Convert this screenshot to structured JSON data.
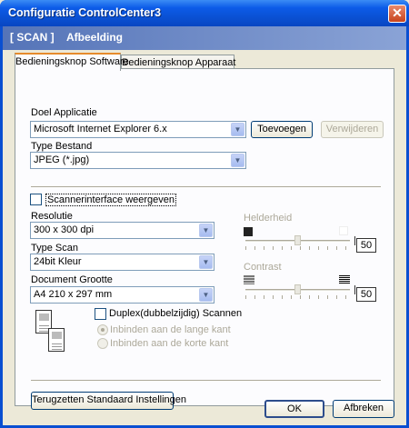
{
  "window": {
    "title": "Configuratie ControlCenter3",
    "close_symbol": "✕"
  },
  "banner": {
    "section": "[ SCAN ]",
    "subsection": "Afbeelding"
  },
  "tabs": [
    {
      "label": "Bedieningsknop Software",
      "active": true
    },
    {
      "label": "Bedieningsknop Apparaat",
      "active": false
    }
  ],
  "target_app": {
    "label": "Doel Applicatie",
    "value": "Microsoft Internet Explorer 6.x",
    "add_label": "Toevoegen",
    "remove_label": "Verwijderen"
  },
  "file_type": {
    "label": "Type Bestand",
    "value": "JPEG (*.jpg)"
  },
  "scanner_interface": {
    "label": "Scannerinterface weergeven",
    "checked": false
  },
  "resolution": {
    "label": "Resolutie",
    "value": "300 x 300 dpi"
  },
  "scan_type": {
    "label": "Type Scan",
    "value": "24bit Kleur"
  },
  "document_size": {
    "label": "Document Grootte",
    "value": "A4 210 x 297 mm"
  },
  "brightness": {
    "label": "Helderheid",
    "value": "50",
    "level": 0.5
  },
  "contrast": {
    "label": "Contrast",
    "value": "50",
    "level": 0.5
  },
  "duplex": {
    "label": "Duplex(dubbelzijdig) Scannen",
    "checked": false,
    "options": [
      "Inbinden aan de lange kant",
      "Inbinden aan de korte kant"
    ]
  },
  "footer": {
    "reset_label": "Terugzetten Standaard Instellingen",
    "ok_label": "OK",
    "cancel_label": "Afbreken"
  },
  "icons": {
    "close": "close-icon",
    "dropdown": "chevron-down-icon",
    "brightness_low": "brightness-low-icon",
    "brightness_high": "brightness-high-icon",
    "contrast_low": "contrast-low-icon",
    "contrast_high": "contrast-high-icon",
    "duplex": "duplex-document-icon"
  },
  "colors": {
    "titlebar": "#0a4fd1",
    "banner_start": "#5574b8",
    "banner_end": "#8aa3d6",
    "dialog_bg": "#ece9d8",
    "active_tab_accent": "#e68b2c"
  }
}
